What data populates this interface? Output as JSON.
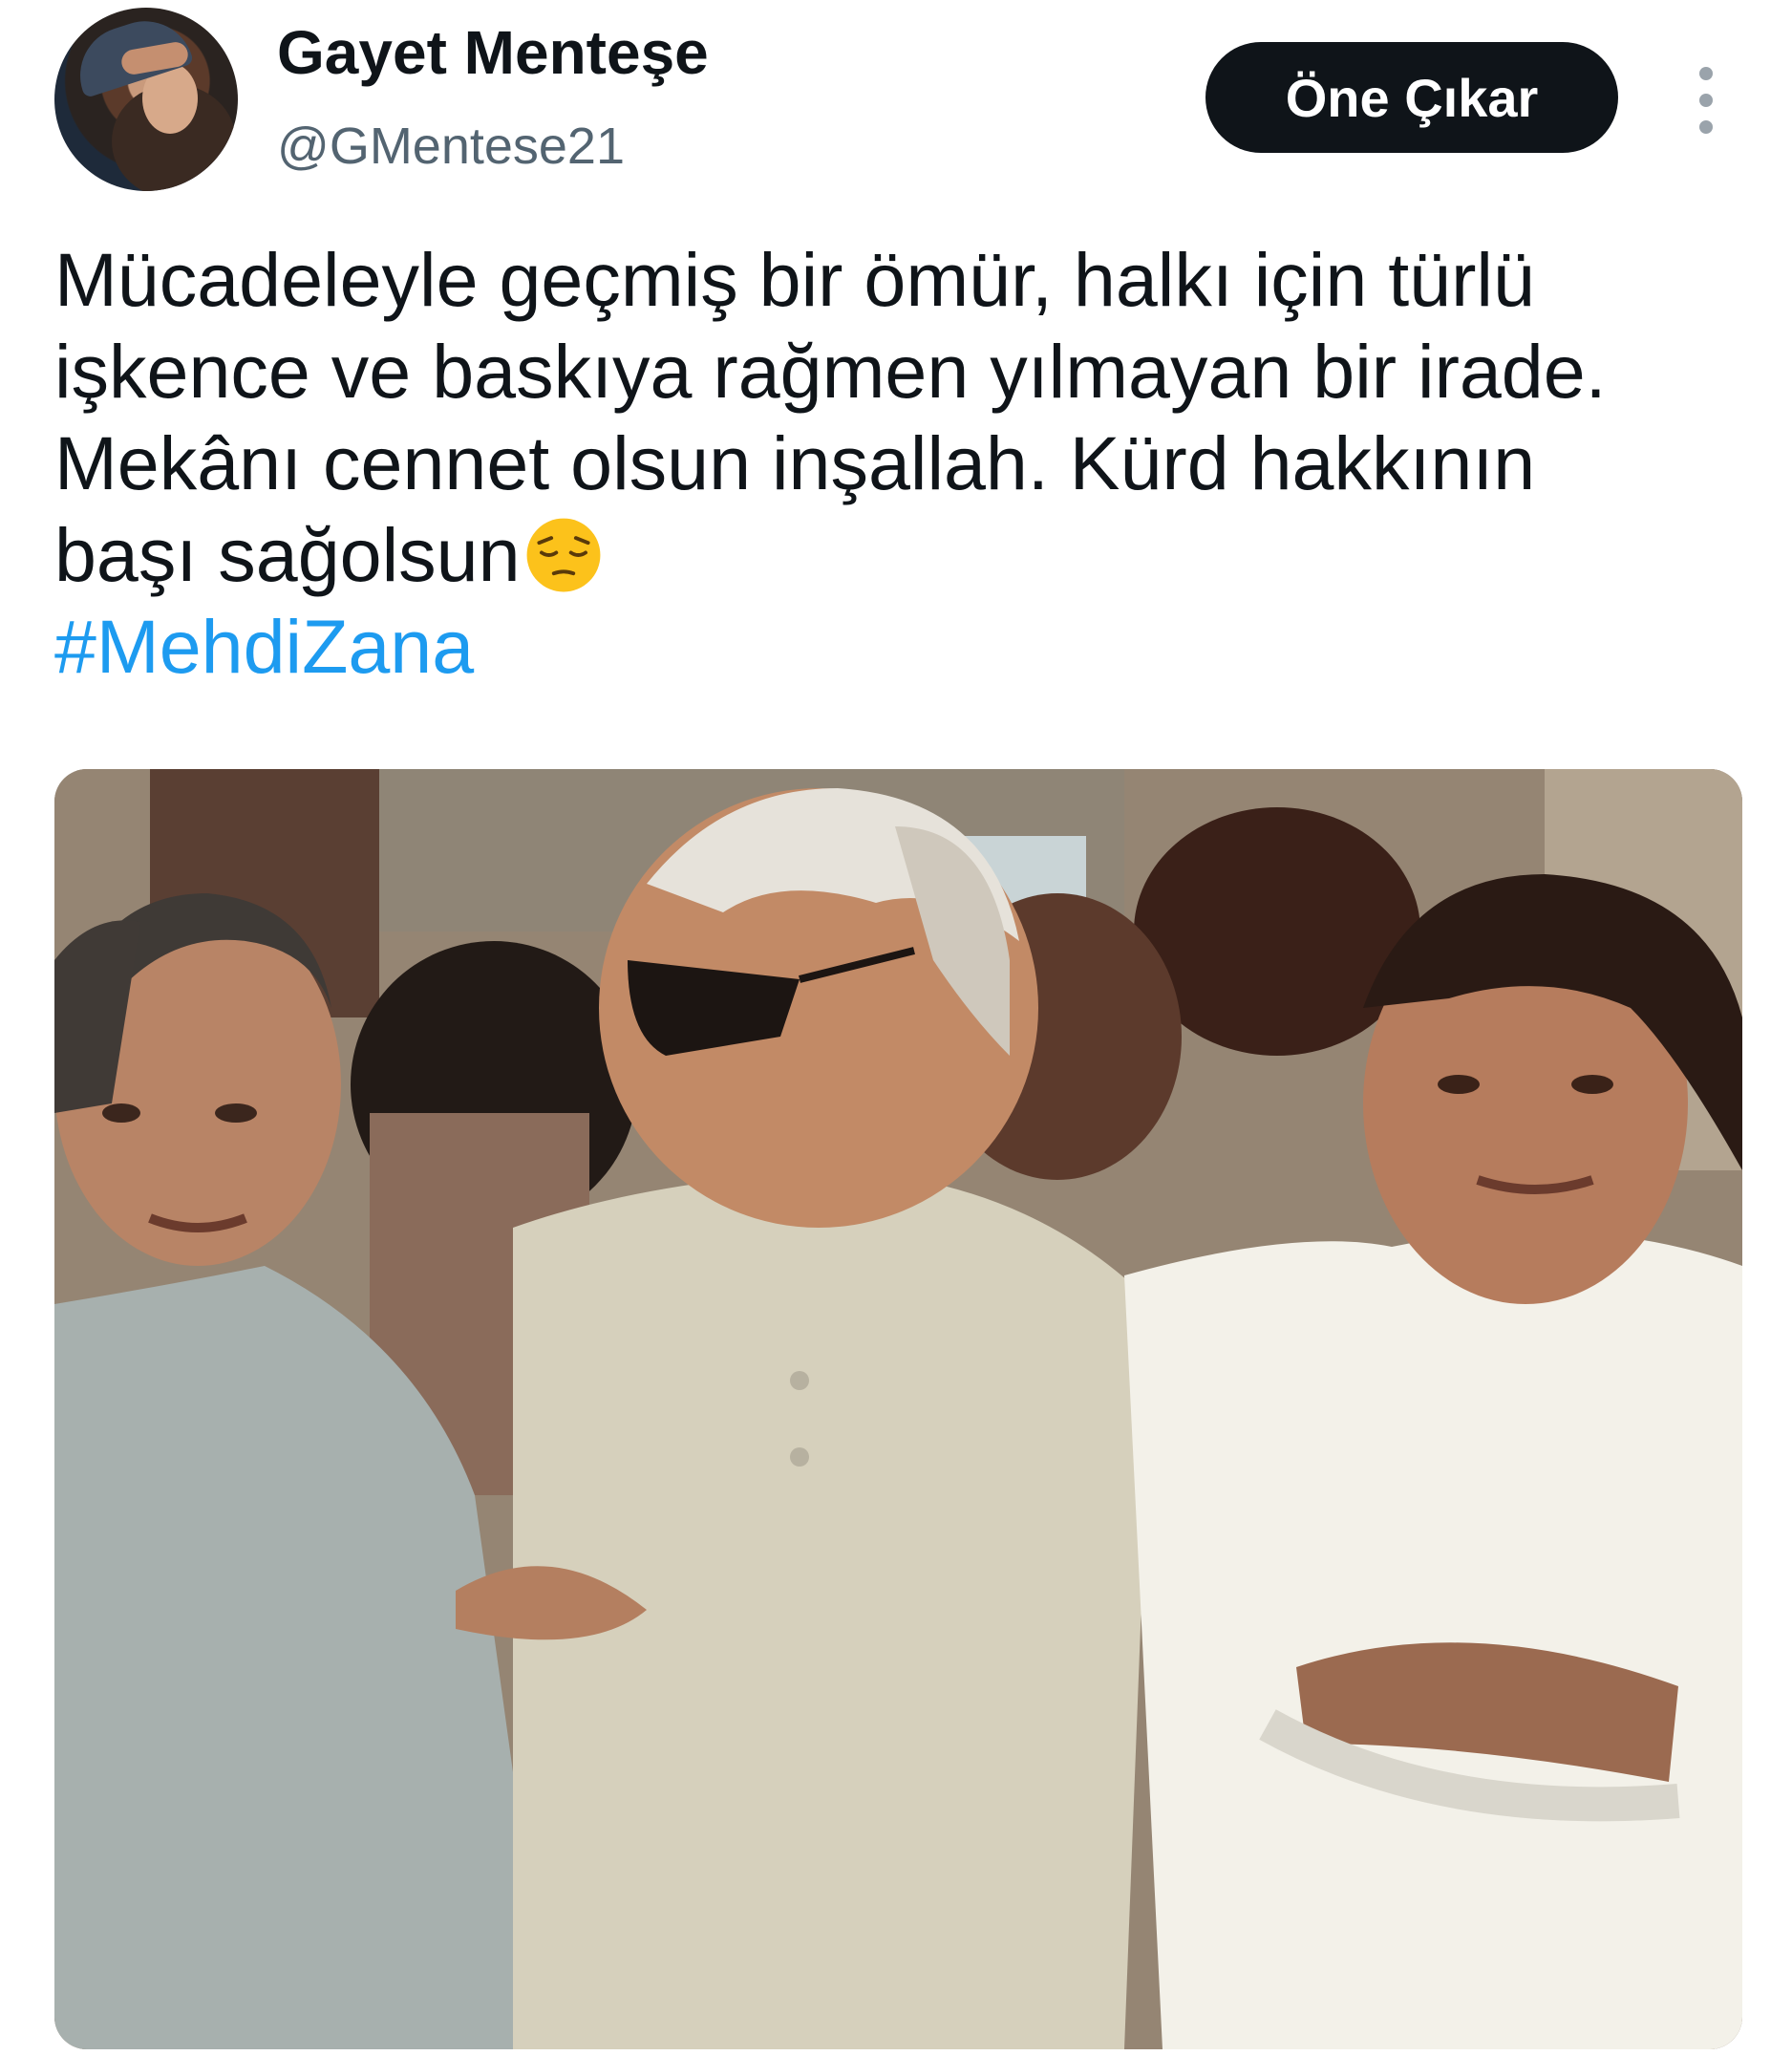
{
  "author": {
    "display_name": "Gayet Menteşe",
    "handle": "@GMentese21",
    "avatar_icon": "profile-photo"
  },
  "actions": {
    "feature_label": "Öne Çıkar",
    "more_icon": "more-vertical-icon"
  },
  "tweet": {
    "lines": [
      "Mücadeleyle geçmiş bir ömür, halkı için türlü",
      "işkence ve baskıya rağmen yılmayan bir irade.",
      "Mekânı cennet olsun inşallah. Kürd hakkının",
      "başı sağolsun"
    ],
    "emoji": "pensive-face-emoji",
    "hashtag": "#MehdiZana",
    "hashtag_color": "#1d9bf0"
  },
  "media": {
    "type": "photo",
    "subject": "vintage-group-photo"
  }
}
